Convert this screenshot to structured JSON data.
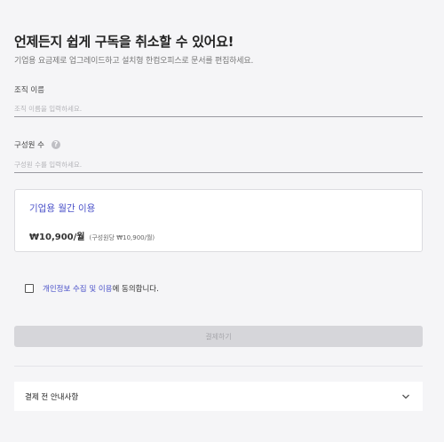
{
  "header": {
    "title": "언제든지 쉽게 구독을 취소할 수 있어요!",
    "subtitle": "기업용 요금제로 업그레이드하고 설치형 한컴오피스로 문서를 편집하세요."
  },
  "form": {
    "org_name": {
      "label": "조직 이름",
      "placeholder": "조직 이름을 입력하세요.",
      "value": ""
    },
    "member_count": {
      "label": "구성원 수",
      "help_icon": "question-circle-icon",
      "help_glyph": "?",
      "placeholder": "구성원 수를 입력하세요.",
      "value": ""
    }
  },
  "plan": {
    "title": "기업용 월간 이용",
    "price": "₩10,900/월",
    "price_detail": "(구성원당 ₩10,900/월)"
  },
  "agreement": {
    "checked": false,
    "link_text": "개인정보 수집 및 이용",
    "suffix_text": "에 동의합니다."
  },
  "actions": {
    "pay_label": "결제하기",
    "pay_enabled": false
  },
  "notice": {
    "label": "결제 전 안내사항",
    "icon": "chevron-down-icon"
  },
  "colors": {
    "accent": "#4b52c9",
    "background": "#f5f5f7",
    "disabled_button": "#d6d6da"
  }
}
